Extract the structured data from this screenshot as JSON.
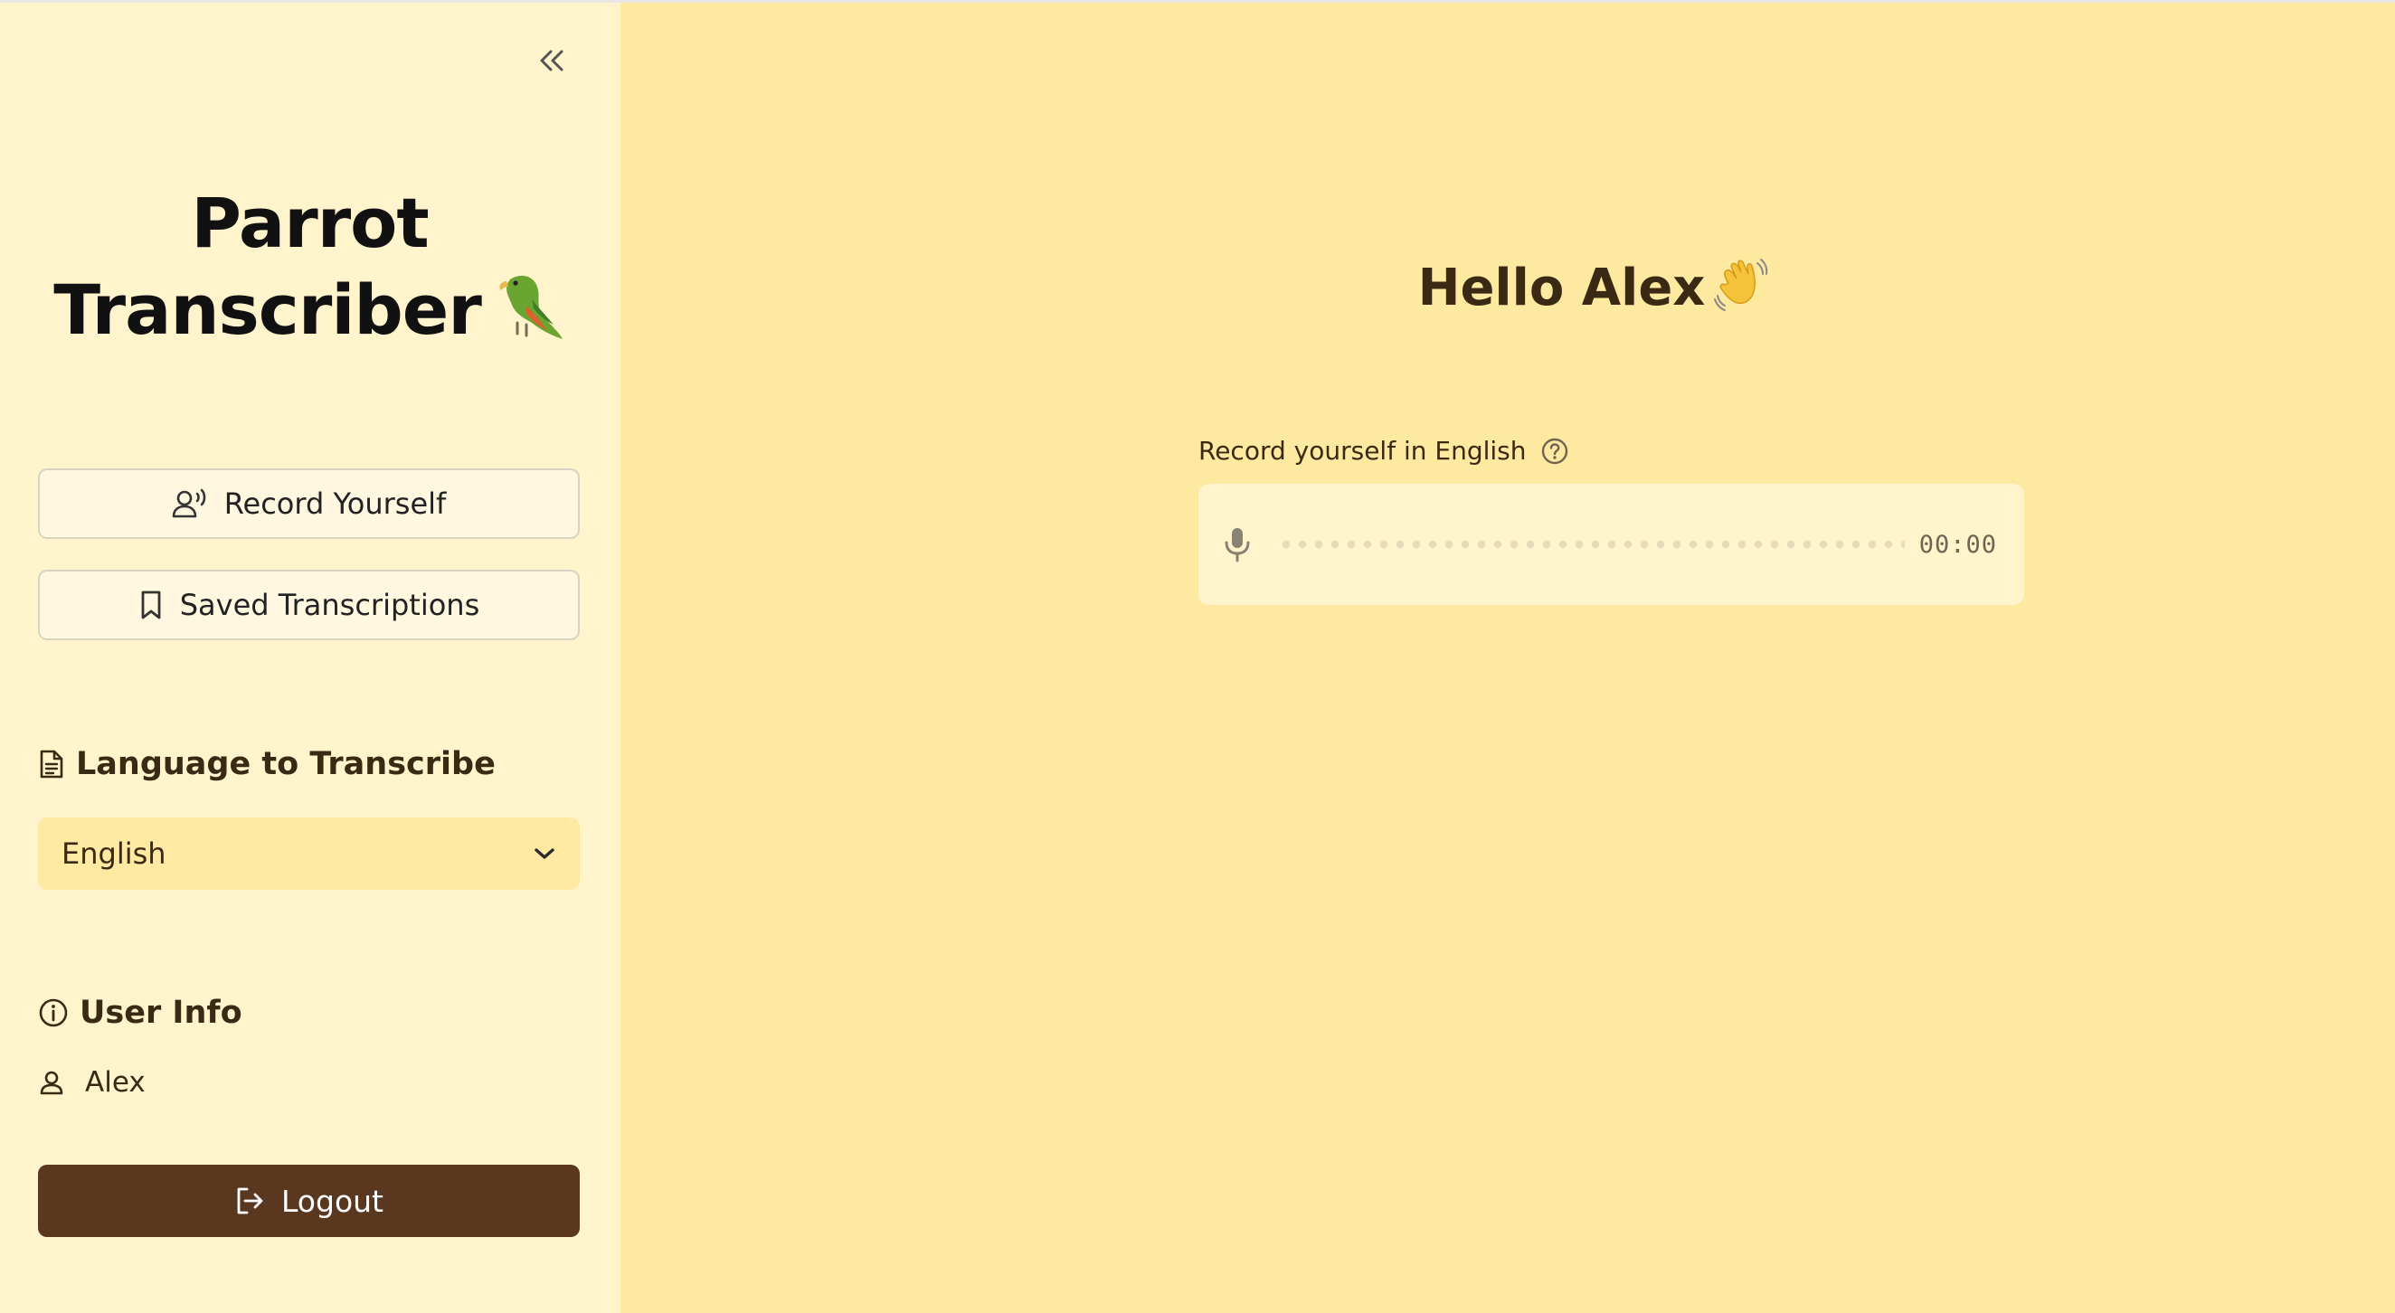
{
  "sidebar": {
    "title_line1": "Parrot",
    "title_line2": "Transcriber",
    "title_emoji": "parrot-emoji",
    "nav": {
      "record_label": "Record Yourself",
      "saved_label": "Saved Transcriptions"
    },
    "language_section": {
      "title": "Language to Transcribe",
      "selected": "English"
    },
    "user_section": {
      "title": "User Info",
      "username": "Alex"
    },
    "logout_label": "Logout"
  },
  "main": {
    "greeting": "Hello Alex",
    "greeting_emoji": "waving-hand-emoji",
    "recorder": {
      "label": "Record yourself in English",
      "timer": "00:00"
    }
  },
  "colors": {
    "sidebar_bg": "#fff4cc",
    "main_bg": "#fee9a0",
    "logout_bg": "#5a3820",
    "text": "#3a2a14"
  }
}
